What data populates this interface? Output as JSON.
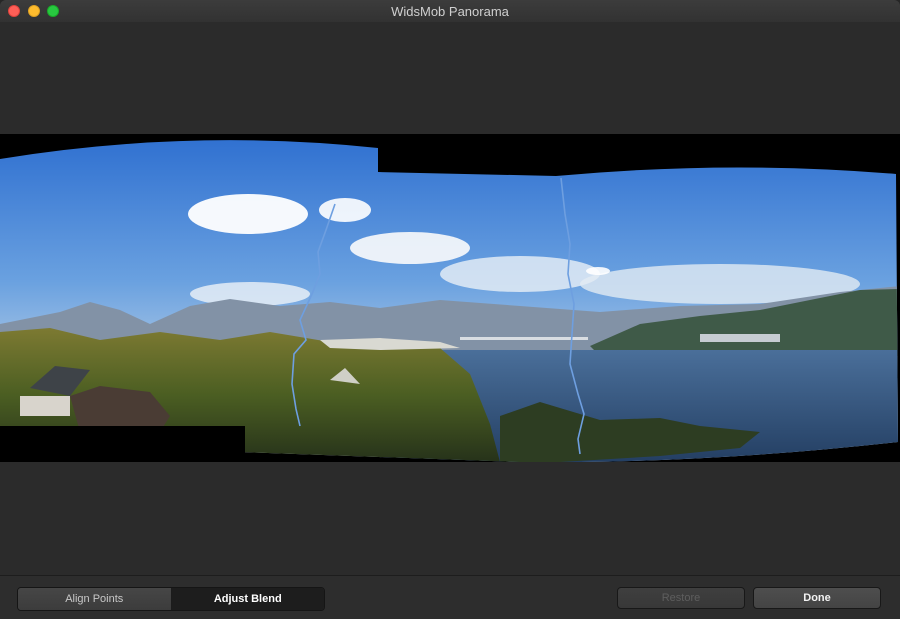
{
  "window": {
    "title": "WidsMob Panorama",
    "controls": [
      "close",
      "minimize",
      "zoom"
    ]
  },
  "bottom_bar": {
    "mode_tabs": [
      {
        "label": "Align Points",
        "active": false
      },
      {
        "label": "Adjust Blend",
        "active": true
      }
    ],
    "restore_label": "Restore",
    "restore_enabled": false,
    "done_label": "Done"
  },
  "colors": {
    "window_bg": "#2a2a2a",
    "seam_line": "#6e9fe0"
  }
}
